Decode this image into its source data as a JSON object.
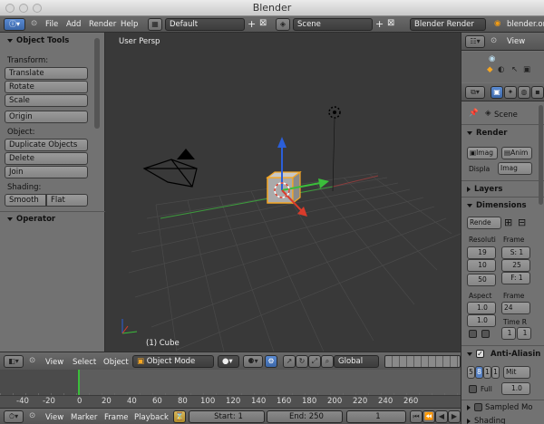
{
  "window": {
    "title": "Blender"
  },
  "menubar": {
    "items": [
      "File",
      "Add",
      "Render",
      "Help"
    ],
    "screen_layout": "Default",
    "scene": "Scene",
    "render_engine": "Blender Render",
    "file_name": "blender.org"
  },
  "tool_shelf": {
    "object_tools_label": "Object Tools",
    "transform_label": "Transform:",
    "transform_buttons": [
      "Translate",
      "Rotate",
      "Scale"
    ],
    "origin_button": "Origin",
    "object_label": "Object:",
    "object_buttons": [
      "Duplicate Objects",
      "Delete",
      "Join"
    ],
    "shading_label": "Shading:",
    "shading_buttons": [
      "Smooth",
      "Flat"
    ],
    "operator_label": "Operator"
  },
  "viewport": {
    "view_name": "User Persp",
    "object_label": "(1) Cube"
  },
  "outliner": {
    "view_label": "View"
  },
  "properties": {
    "scene_label": "Scene",
    "render_label": "Render",
    "image_button": "Imag",
    "anim_button": "Anim",
    "display_label": "Displa",
    "display_value": "Imag",
    "layers_label": "Layers",
    "dimensions_label": "Dimensions",
    "render_preset": "Rende",
    "resolution_label": "Resoluti",
    "frame_label": "Frame",
    "res_x": "19",
    "res_y": "10",
    "res_pct": "50",
    "frame_start": "S: 1",
    "frame_end": "25",
    "frame_step": "F: 1",
    "aspect_label": "Aspect",
    "aspect_x": "1.0",
    "aspect_y": "1.0",
    "frame_rate_label": "Frame",
    "frame_rate": "24",
    "time_remap_label": "Time R",
    "time_old": "1",
    "time_new": "1",
    "anti_alias_label": "Anti-Aliasin",
    "aa_samples": [
      "5",
      "8",
      "1",
      "1"
    ],
    "aa_filter": "Mit",
    "full_label": "Full",
    "filter_size": "1.0",
    "sampled_motion_label": "Sampled Mo",
    "shading_label": "Shading"
  },
  "view_header": {
    "menu_items": [
      "View",
      "Select",
      "Object"
    ],
    "mode": "Object Mode",
    "orientation": "Global"
  },
  "timeline": {
    "ticks": [
      "-40",
      "-20",
      "0",
      "20",
      "40",
      "60",
      "80",
      "100",
      "120",
      "140",
      "160",
      "180",
      "200",
      "220",
      "240",
      "260"
    ],
    "current_frame": 1
  },
  "timeline_header": {
    "menu_items": [
      "View",
      "Marker",
      "Frame",
      "Playback"
    ],
    "start_label": "Start: 1",
    "end_label": "End: 250",
    "current_frame": "1"
  },
  "colors": {
    "accent": "#5680c2",
    "selection": "#f5a623",
    "timeline_cursor": "#3bbd3b"
  }
}
